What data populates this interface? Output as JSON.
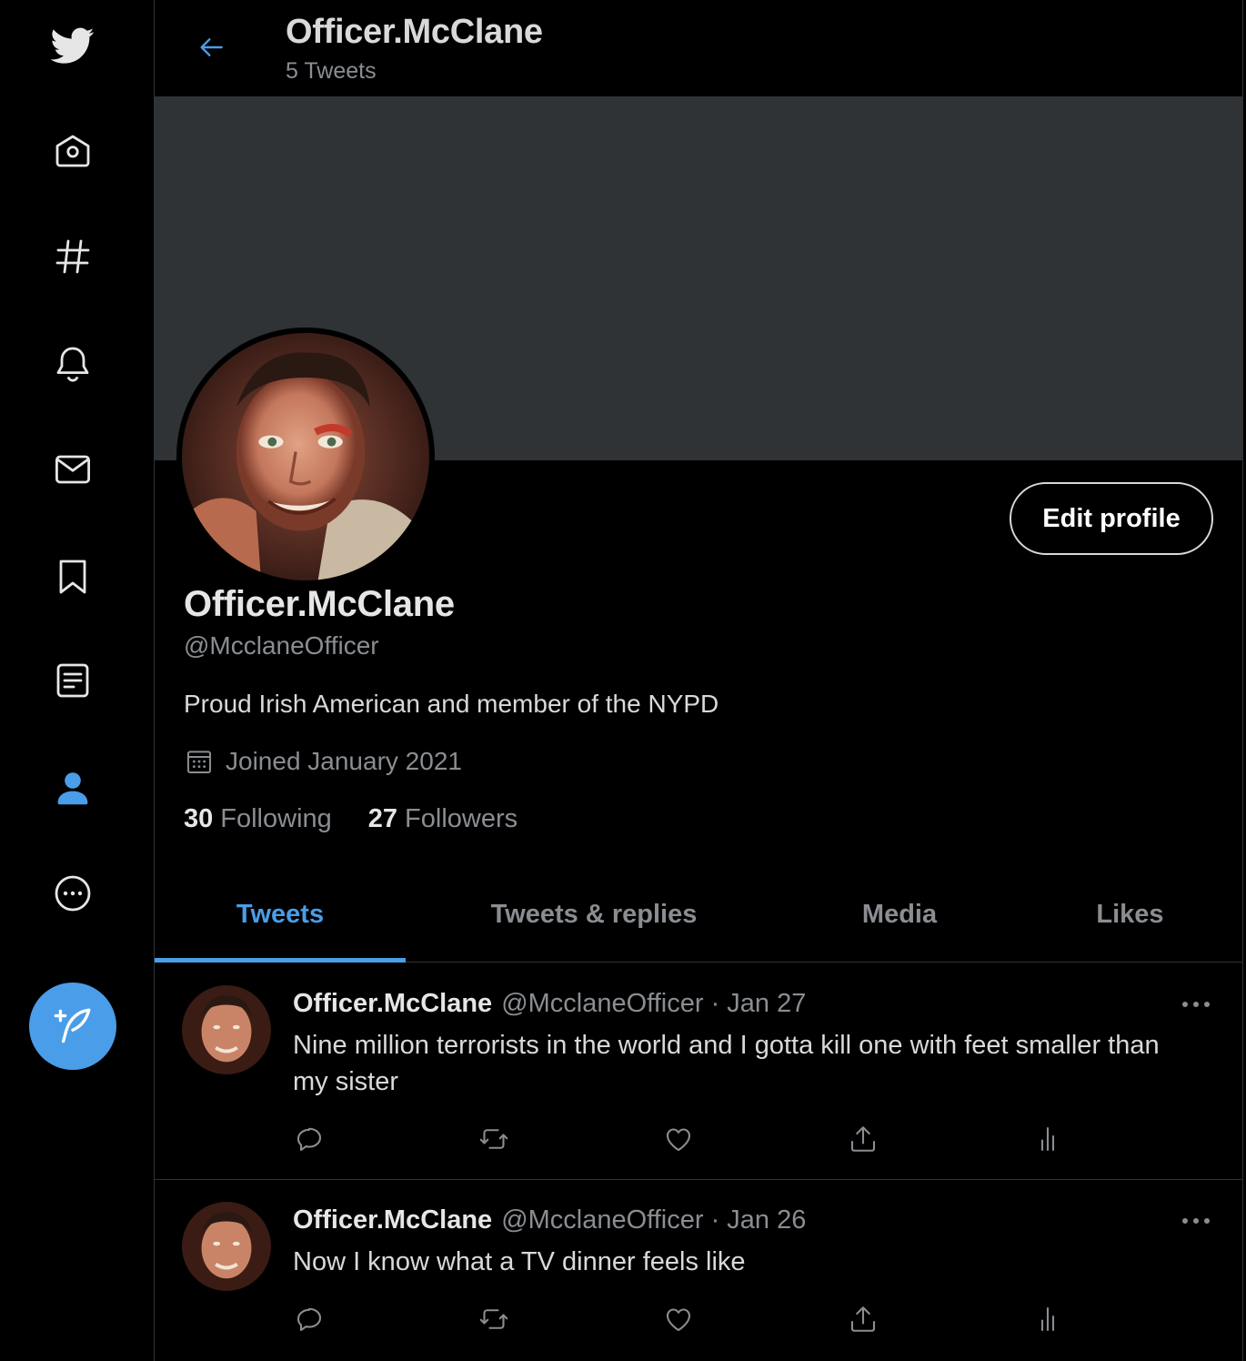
{
  "header": {
    "title": "Officer.McClane",
    "subtitle": "5 Tweets"
  },
  "nav": {
    "items": [
      {
        "icon": "twitter-logo-icon"
      },
      {
        "icon": "home-icon"
      },
      {
        "icon": "explore-hashtag-icon"
      },
      {
        "icon": "notifications-bell-icon"
      },
      {
        "icon": "messages-mail-icon"
      },
      {
        "icon": "bookmarks-icon"
      },
      {
        "icon": "lists-icon"
      },
      {
        "icon": "profile-icon"
      },
      {
        "icon": "more-icon"
      }
    ],
    "compose_icon": "compose-tweet-icon"
  },
  "profile": {
    "edit_button": "Edit profile",
    "name": "Officer.McClane",
    "handle": "@McclaneOfficer",
    "bio": "Proud Irish American and member of the NYPD",
    "joined": "Joined January 2021",
    "following_count": "30",
    "following_label": "Following",
    "followers_count": "27",
    "followers_label": "Followers"
  },
  "tabs": [
    {
      "label": "Tweets",
      "active": true
    },
    {
      "label": "Tweets & replies",
      "active": false
    },
    {
      "label": "Media",
      "active": false
    },
    {
      "label": "Likes",
      "active": false
    }
  ],
  "tweets": [
    {
      "name": "Officer.McClane",
      "handle": "@McclaneOfficer",
      "date": "· Jan 27",
      "text": "Nine million terrorists in the world and I gotta kill one with feet smaller than my sister"
    },
    {
      "name": "Officer.McClane",
      "handle": "@McclaneOfficer",
      "date": "· Jan 26",
      "text": "Now I know what a TV dinner feels like"
    }
  ],
  "colors": {
    "accent": "#4a9de8",
    "background": "#000000",
    "banner": "#2f3336",
    "muted_text": "#8a8d91"
  }
}
